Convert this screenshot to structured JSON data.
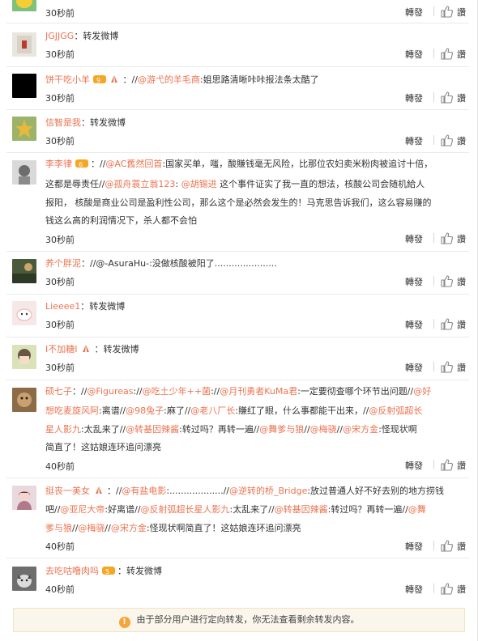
{
  "actions": {
    "forward": "轉發",
    "praise": "讚"
  },
  "items": [
    {
      "time": "30秒前"
    },
    {
      "user": "JGJJGG",
      "text": "：转发微博",
      "time": "30秒前"
    },
    {
      "user": "饼干吃小羊",
      "pre": "：//",
      "mention": "@游弋的羊毛商",
      "text": ":姐思路清晰咔咔报法条太酷了",
      "time": "30秒前"
    },
    {
      "user": "信智是我",
      "text": "：转发微博",
      "time": "30秒前"
    },
    {
      "user": "李李律",
      "lines": [
        {
          "pre": "：//",
          "mention": "@AC舊然回首",
          "text": ":国家买单，嗤，酸賺钱毫无风险，比那位农妇卖米粉肉被追讨十倍，"
        },
        {
          "pre": "这都是辱责任//",
          "mention": "@孤舟蓑立翁123",
          "mid": ": ",
          "mention2": "@胡锡进",
          "text": " 这个事件证实了我一直的想法，核酸公司会随机給人"
        },
        {
          "text": "报阳， 核酸是商业公司是盈利性公司，那么这个是必然会发生的！马克思告诉我们，这么容易赚的"
        },
        {
          "text": "钱这么高的利润情况下，杀人都不会怕"
        }
      ],
      "time": "30秒前"
    },
    {
      "user": "养个胖泥",
      "text": "：//@-AsuraHu-:没做核酸被阳了......................",
      "time": "30秒前"
    },
    {
      "user": "Lieeee1",
      "text": "：转发微博",
      "time": "30秒前"
    },
    {
      "user": "I不加糖I",
      "text": "：转发微博",
      "time": "30秒前"
    },
    {
      "user": "硕七子",
      "lines": [
        {
          "pre": "：//",
          "mention": "@Figureas",
          "mid": ":",
          "pre2": "//",
          "mention2": "@吃土少年++菌",
          "mid2": ":",
          "pre3": "//",
          "mention3": "@月刊勇者KuMa君",
          "text": ":一定要彻查哪个环节出问题//",
          "mention4": "@好"
        },
        {
          "mention": "想吃麦旋风阿",
          "text": ":离谱//",
          "mention2": "@98兔子",
          "text2": ":麻了//",
          "mention3": "@老八厂长",
          "text3": ":賺红了眼，什么事都能干出来，//",
          "mention4": "@反射弧超长"
        },
        {
          "mention": "星人影九",
          "text": ":太乱来了//",
          "mention2": "@转基因辣酱",
          "text2": ":转过吗？再转一遍//",
          "mention3": "@舞爹与狼",
          "text3": "//",
          "mention4": "@梅骁",
          "text4": "//",
          "mention5": "@宋方金",
          "text5": ":怪现状啊"
        },
        {
          "text": "简直了！这姑娘连环追问漂亮"
        }
      ],
      "time": "40秒前"
    },
    {
      "user": "挺丧一美女",
      "lines": [
        {
          "pre": "：//",
          "mention": "@有盐电影",
          "text": ":...................//",
          "mention2": "@逆转的桥_Bridge",
          "text2": ":放过普通人好不好去别的地方捞钱"
        },
        {
          "text": "吧//",
          "mention": "@亚尼大帝",
          "text2": ":好离谱//",
          "mention2": "@反射弧超长星人影九",
          "text3": ":太乱来了//",
          "mention3": "@转基因辣酱",
          "text4": ":转过吗？再转一遍//",
          "mention4": "@舞"
        },
        {
          "mention": "爹与狼",
          "text": "//",
          "mention2": "@梅骁",
          "text2": "//",
          "mention3": "@宋方金",
          "text3": ":怪现状啊简直了！这姑娘连环追问漂亮"
        }
      ],
      "time": "40秒前"
    },
    {
      "user": "去吃咕噜肉吗",
      "text": "：转发微博",
      "time": "40秒前"
    }
  ],
  "notice": "由于部分用户进行定向转发，你无法查看剩余转发内容。"
}
